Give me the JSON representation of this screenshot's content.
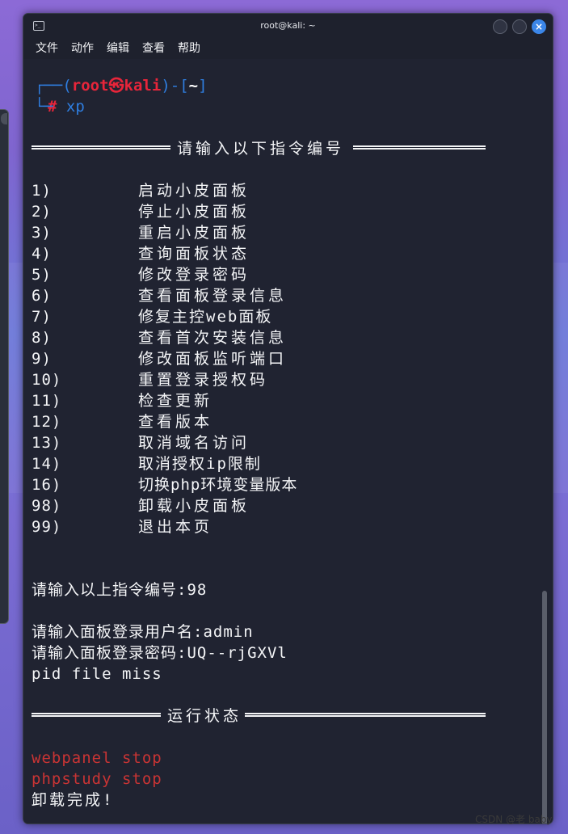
{
  "window": {
    "title": "root@kali: ~",
    "close_glyph": "×"
  },
  "menu": [
    "文件",
    "动作",
    "编辑",
    "查看",
    "帮助"
  ],
  "prompt": {
    "open": "┌──(",
    "user": "root",
    "at": "㉿",
    "host": "kali",
    "mid": ")-[",
    "path": "~",
    "close": "]",
    "hash": "#",
    "command": "xp"
  },
  "header_rule": "请输入以下指令编号",
  "options": [
    {
      "num": "1)",
      "label": "启动小皮面板"
    },
    {
      "num": "2)",
      "label": "停止小皮面板"
    },
    {
      "num": "3)",
      "label": "重启小皮面板"
    },
    {
      "num": "4)",
      "label": "查询面板状态"
    },
    {
      "num": "5)",
      "label": "修改登录密码"
    },
    {
      "num": "6)",
      "label": "查看面板登录信息"
    },
    {
      "num": "7)",
      "label": "修复主控web面板"
    },
    {
      "num": "8)",
      "label": "查看首次安装信息"
    },
    {
      "num": "9)",
      "label": "修改面板监听端口"
    },
    {
      "num": "10)",
      "label": "重置登录授权码"
    },
    {
      "num": "11)",
      "label": "检查更新"
    },
    {
      "num": "12)",
      "label": "查看版本"
    },
    {
      "num": "13)",
      "label": "取消域名访问"
    },
    {
      "num": "14)",
      "label": "取消授权ip限制"
    },
    {
      "num": "16)",
      "label": "切换php环境变量版本"
    },
    {
      "num": "98)",
      "label": "卸载小皮面板"
    },
    {
      "num": "99)",
      "label": "退出本页"
    }
  ],
  "input_line": "请输入以上指令编号:98",
  "username_line": "请输入面板登录用户名:admin",
  "password_line": "请输入面板登录密码:UQ--rjGXVl",
  "pid_line": "pid file miss",
  "status_rule": "运行状态",
  "status_lines": [
    "webpanel stop",
    "phpstudy stop"
  ],
  "done_line": "卸载完成!",
  "watermark": "CSDN @老 baby"
}
